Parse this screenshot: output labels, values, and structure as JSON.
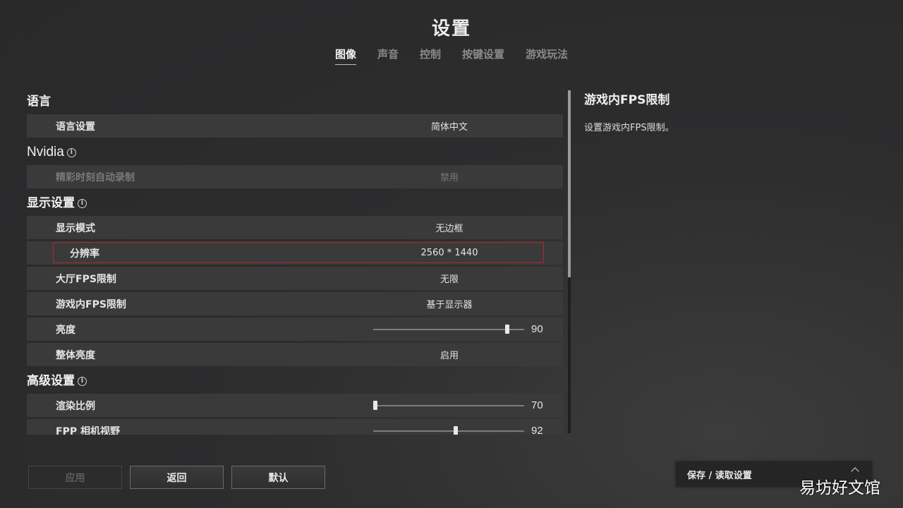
{
  "header": {
    "title": "设置",
    "tabs": [
      "图像",
      "声音",
      "控制",
      "按键设置",
      "游戏玩法"
    ],
    "active_tab": 0
  },
  "sections": {
    "language": {
      "title": "语言",
      "rows": [
        {
          "label": "语言设置",
          "value": "简体中文"
        }
      ]
    },
    "nvidia": {
      "title": "Nvidia",
      "rows": [
        {
          "label": "精彩时刻自动录制",
          "value": "禁用"
        }
      ]
    },
    "display": {
      "title": "显示设置",
      "rows": [
        {
          "label": "显示模式",
          "value": "无边框"
        },
        {
          "label": "分辨率",
          "value": "2560 * 1440"
        },
        {
          "label": "大厅FPS限制",
          "value": "无限"
        },
        {
          "label": "游戏内FPS限制",
          "value": "基于显示器"
        },
        {
          "label": "亮度",
          "value": "90",
          "level": 0.9
        },
        {
          "label": "整体亮度",
          "value": "启用"
        }
      ]
    },
    "advanced": {
      "title": "高级设置",
      "rows": [
        {
          "label": "渲染比例",
          "value": "70",
          "level": 0.0
        },
        {
          "label": "FPP 相机视野",
          "value": "92",
          "level": 0.55
        }
      ]
    }
  },
  "description": {
    "title": "游戏内FPS限制",
    "text": "设置游戏内FPS限制。"
  },
  "buttons": {
    "apply": "应用",
    "back": "返回",
    "default": "默认"
  },
  "save_panel": {
    "label": "保存 / 读取设置"
  },
  "watermark": "易坊好文馆",
  "colors": {
    "highlight_border": "#b3262b",
    "row_bg": "#3a3a3b"
  },
  "icons": {
    "info": "info-icon",
    "expand": "chevron-up-icon"
  }
}
